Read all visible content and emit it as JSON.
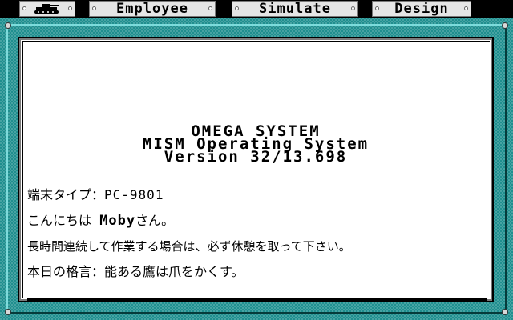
{
  "menu": {
    "tank_icon": "tank-icon",
    "employee_label": "Employee",
    "simulate_label": "Simulate",
    "design_label": "Design"
  },
  "banner": {
    "line1": "OMEGA SYSTEM",
    "line2": "MISM Operating System",
    "line3": "Version 32/13.698"
  },
  "info": {
    "terminal_label": "端末タイプ：",
    "terminal_value": "PC-9801",
    "greeting_prefix": "こんにちは",
    "user_name": "Moby",
    "greeting_suffix": "さん。",
    "rest_notice": "長時間連続して作業する場合は、必ず休憩を取って下さい。",
    "proverb_label": "本日の格言：",
    "proverb_text": "能ある鷹は爪をかくす。"
  },
  "colors": {
    "frame": "#1f8f8f",
    "menubar": "#000000",
    "menu_button": "#e6e6e6",
    "panel": "#ffffff"
  }
}
